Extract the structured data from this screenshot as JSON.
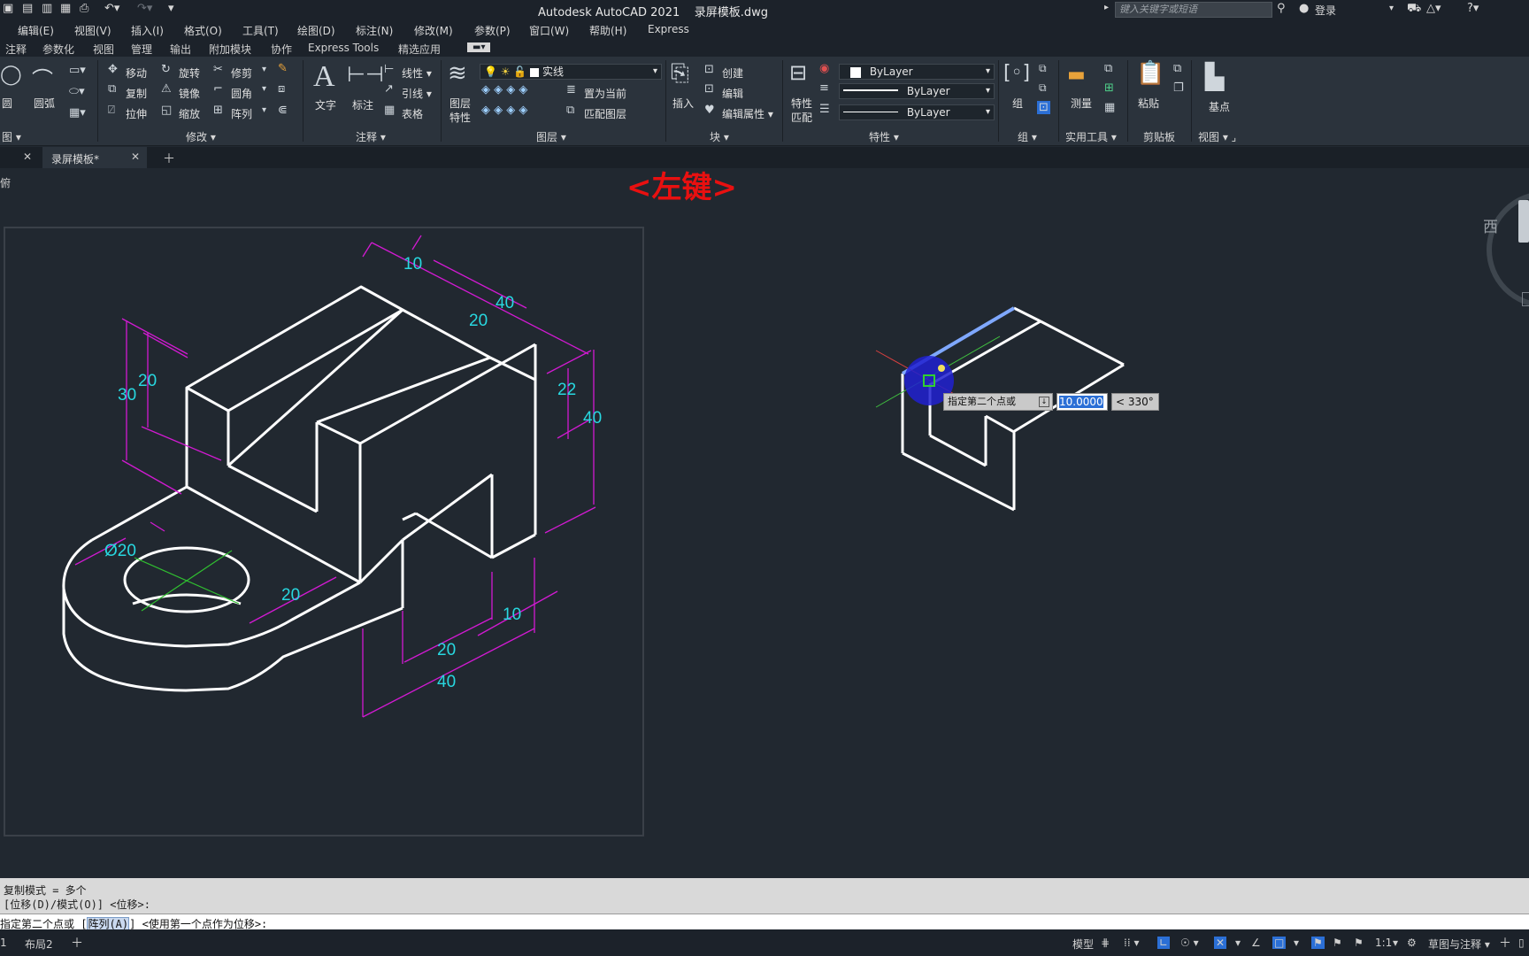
{
  "titlebar": {
    "app_name": "Autodesk AutoCAD 2021",
    "file_name": "录屏模板.dwg",
    "search_placeholder": "键入关键字或短语",
    "login": "登录"
  },
  "menu": [
    "编辑(E)",
    "视图(V)",
    "插入(I)",
    "格式(O)",
    "工具(T)",
    "绘图(D)",
    "标注(N)",
    "修改(M)",
    "参数(P)",
    "窗口(W)",
    "帮助(H)",
    "Express"
  ],
  "ribbon_tabs": [
    "注释",
    "参数化",
    "视图",
    "管理",
    "输出",
    "附加模块",
    "协作",
    "Express Tools",
    "精选应用"
  ],
  "ribbon": {
    "draw": {
      "circle": "圆",
      "arc": "圆弧",
      "panel": "图"
    },
    "modify": {
      "move": "移动",
      "rotate": "旋转",
      "trim": "修剪",
      "copy": "复制",
      "mirror": "镜像",
      "fillet": "圆角",
      "stretch": "拉伸",
      "scale": "缩放",
      "array": "阵列",
      "panel": "修改"
    },
    "annotation": {
      "text": "文字",
      "dimension": "标注",
      "linear": "线性",
      "leader": "引线",
      "table": "表格",
      "panel": "注释"
    },
    "layers": {
      "properties_1": "图层",
      "properties_2": "特性",
      "layer_name": "实线",
      "set_current": "置为当前",
      "match_layer": "匹配图层",
      "panel": "图层"
    },
    "block": {
      "insert": "插入",
      "create": "创建",
      "edit": "编辑",
      "edit_attr": "编辑属性",
      "panel": "块"
    },
    "properties": {
      "match_1": "特性",
      "match_2": "匹配",
      "color": "ByLayer",
      "linetype": "ByLayer",
      "lineweight": "ByLayer",
      "panel": "特性"
    },
    "groups": {
      "group": "组",
      "panel": "组"
    },
    "utilities": {
      "measure": "测量",
      "panel": "实用工具"
    },
    "clipboard": {
      "paste": "粘贴",
      "panel": "剪贴板"
    },
    "view": {
      "base": "基点",
      "panel": "视图"
    }
  },
  "doc_tab": {
    "name": "录屏模板*"
  },
  "viewport_label": "俯",
  "overlay_label": "<左键>",
  "viewcube_label": "西",
  "drawing": {
    "dims": [
      "10",
      "40",
      "20",
      "30",
      "20",
      "22",
      "40",
      "Ø20",
      "20",
      "10",
      "20",
      "40"
    ]
  },
  "dynamic_input": {
    "prompt": "指定第二个点或",
    "value": "10.0000",
    "angle": "< 330°"
  },
  "command": {
    "history_1": "复制模式 = 多个",
    "history_2": "[位移(D)/模式(O)] <位移>:",
    "prompt_a": "指定第二个点或 [",
    "array_option": "阵列(A)",
    "prompt_b": "] <使用第一个点作为位移>:"
  },
  "status": {
    "model": "模型",
    "layout": "布局2",
    "scale": "1:1",
    "workspace": "草图与注释"
  },
  "colors": {
    "dimension": "#28d8e0",
    "dim_line": "#d21ad2",
    "overlay": "#e81010",
    "accent": "#2b6fd6"
  }
}
